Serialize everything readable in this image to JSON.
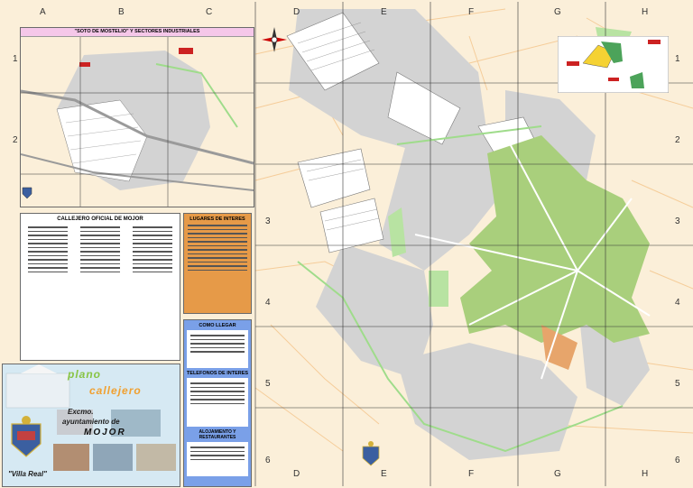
{
  "grid": {
    "columns": [
      "A",
      "B",
      "C",
      "D",
      "E",
      "F",
      "G",
      "H"
    ],
    "rows": [
      "1",
      "2",
      "3",
      "4",
      "5",
      "6"
    ]
  },
  "inset": {
    "title": "\"SOTO DE MOSTELIO\" Y SECTORES INDUSTRIALES"
  },
  "index_panel": {
    "title": "CALLEJERO OFICIAL DE MOJOR"
  },
  "places_panel": {
    "title": "LUGARES DE INTERES"
  },
  "howto_panel": {
    "title": "COMO LLEGAR"
  },
  "phones_panel": {
    "title": "TELEFONOS DE INTERES"
  },
  "lodging_panel": {
    "title": "ALOJAMIENTO Y RESTAURANTES"
  },
  "cover": {
    "word1": "plano",
    "word2": "callejero",
    "line1": "Excmo.",
    "line2": "ayuntamiento de",
    "town": "MOJOR",
    "motto": "\"Villa Real\""
  },
  "colors": {
    "map_bg": "#fbefd9",
    "old_town": "#a9cf7c",
    "blocks": "#d3d3d3",
    "parks": "#b8e3a2",
    "places_panel": "#e69a48",
    "howto_panel": "#7aa0e8",
    "inset_header": "#f5c7e9"
  },
  "icons": [
    "compass-rose-icon",
    "coat-of-arms-icon",
    "locator-map-icon"
  ]
}
